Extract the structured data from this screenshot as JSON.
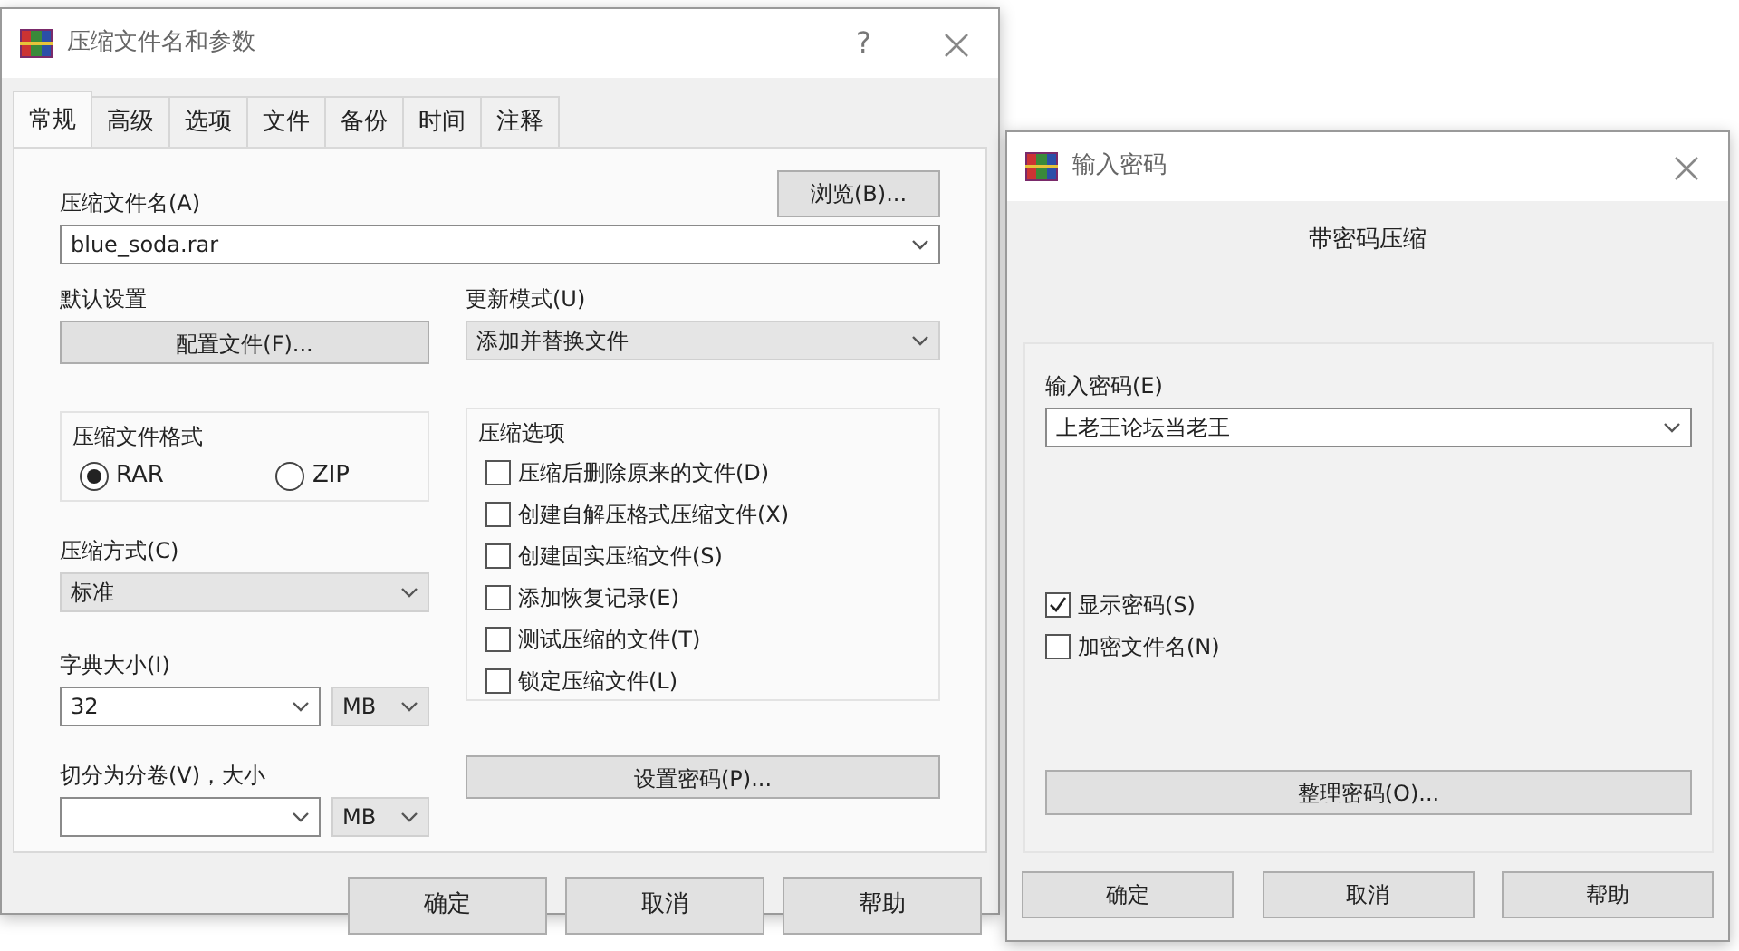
{
  "main_dialog": {
    "title": "压缩文件名和参数",
    "help_glyph": "?",
    "tabs": [
      {
        "label": "常规",
        "selected": true
      },
      {
        "label": "高级",
        "selected": false
      },
      {
        "label": "选项",
        "selected": false
      },
      {
        "label": "文件",
        "selected": false
      },
      {
        "label": "备份",
        "selected": false
      },
      {
        "label": "时间",
        "selected": false
      },
      {
        "label": "注释",
        "selected": false
      }
    ],
    "archive_name": {
      "label": "压缩文件名(A)",
      "value": "blue_soda.rar",
      "browse_button": "浏览(B)..."
    },
    "default_settings": {
      "label": "默认设置",
      "button": "配置文件(F)..."
    },
    "update_mode": {
      "label": "更新模式(U)",
      "value": "添加并替换文件"
    },
    "archive_format": {
      "label": "压缩文件格式",
      "options": [
        {
          "label": "RAR",
          "selected": true
        },
        {
          "label": "ZIP",
          "selected": false
        }
      ]
    },
    "compression_method": {
      "label": "压缩方式(C)",
      "value": "标准"
    },
    "dictionary_size": {
      "label": "字典大小(I)",
      "value": "32",
      "unit": "MB"
    },
    "split_volumes": {
      "label": "切分为分卷(V)，大小",
      "unit": "MB"
    },
    "compression_options": {
      "label": "压缩选项",
      "items": [
        {
          "label": "压缩后删除原来的文件(D)",
          "checked": false
        },
        {
          "label": "创建自解压格式压缩文件(X)",
          "checked": false
        },
        {
          "label": "创建固实压缩文件(S)",
          "checked": false
        },
        {
          "label": "添加恢复记录(E)",
          "checked": false
        },
        {
          "label": "测试压缩的文件(T)",
          "checked": false
        },
        {
          "label": "锁定压缩文件(L)",
          "checked": false
        }
      ]
    },
    "set_password_button": "设置密码(P)...",
    "buttons": [
      "确定",
      "取消",
      "帮助"
    ]
  },
  "password_dialog": {
    "title": "输入密码",
    "heading": "带密码压缩",
    "password": {
      "label": "输入密码(E)",
      "value": "上老王论坛当老王"
    },
    "options": [
      {
        "label": "显示密码(S)",
        "checked": true
      },
      {
        "label": "加密文件名(N)",
        "checked": false
      }
    ],
    "organize_button": "整理密码(O)...",
    "buttons": [
      "确定",
      "取消",
      "帮助"
    ]
  }
}
